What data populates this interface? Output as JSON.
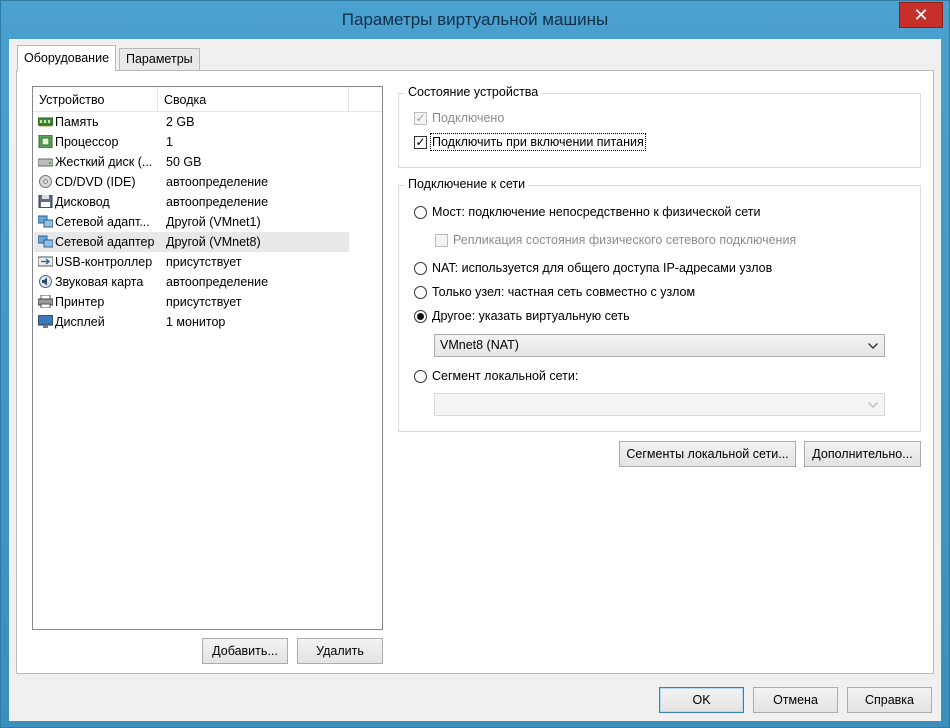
{
  "window": {
    "title": "Параметры виртуальной машины",
    "close_glyph": "✕"
  },
  "tabs": [
    {
      "label": "Оборудование",
      "active": true
    },
    {
      "label": "Параметры",
      "active": false
    }
  ],
  "device_list": {
    "columns": [
      "Устройство",
      "Сводка"
    ],
    "rows": [
      {
        "device": "Память",
        "summary": "2 GB",
        "icon": "memory-icon"
      },
      {
        "device": "Процессор",
        "summary": "1",
        "icon": "cpu-icon"
      },
      {
        "device": "Жесткий диск (...",
        "summary": "50 GB",
        "icon": "hard-disk-icon"
      },
      {
        "device": "CD/DVD (IDE)",
        "summary": "автоопределение",
        "icon": "cd-dvd-icon"
      },
      {
        "device": "Дисковод",
        "summary": "автоопределение",
        "icon": "floppy-icon"
      },
      {
        "device": "Сетевой адапт...",
        "summary": "Другой (VMnet1)",
        "icon": "network-adapter-icon"
      },
      {
        "device": "Сетевой адаптер",
        "summary": "Другой (VMnet8)",
        "icon": "network-adapter-icon",
        "selected": true
      },
      {
        "device": "USB-контроллер",
        "summary": "присутствует",
        "icon": "usb-icon"
      },
      {
        "device": "Звуковая карта",
        "summary": "автоопределение",
        "icon": "sound-card-icon"
      },
      {
        "device": "Принтер",
        "summary": "присутствует",
        "icon": "printer-icon"
      },
      {
        "device": "Дисплей",
        "summary": "1 монитор",
        "icon": "display-icon"
      }
    ]
  },
  "list_buttons": {
    "add": "Добавить...",
    "remove": "Удалить"
  },
  "device_status": {
    "title": "Состояние устройства",
    "connected": {
      "label": "Подключено",
      "checked": true,
      "enabled": false
    },
    "connect_at_power_on": {
      "label": "Подключить при включении питания",
      "checked": true,
      "enabled": true
    }
  },
  "network_connection": {
    "title": "Подключение к сети",
    "bridged": {
      "label": "Мост: подключение непосредственно к физической сети",
      "selected": false
    },
    "replicate": {
      "label": "Репликация состояния физического сетевого подключения",
      "checked": false,
      "enabled": false
    },
    "nat": {
      "label": "NAT: используется для общего доступа IP-адресами узлов",
      "selected": false
    },
    "host_only": {
      "label": "Только узел: частная сеть совместно с узлом",
      "selected": false
    },
    "custom": {
      "label": "Другое: указать виртуальную сеть",
      "selected": true
    },
    "custom_network_value": "VMnet8 (NAT)",
    "lan_segment": {
      "label": "Сегмент локальной сети:",
      "selected": false
    },
    "lan_segment_value": ""
  },
  "action_buttons": {
    "lan_segments": "Сегменты локальной сети...",
    "advanced": "Дополнительно..."
  },
  "dialog_buttons": {
    "ok": "OK",
    "cancel": "Отмена",
    "help": "Справка"
  },
  "colors": {
    "window_accent": "#3b8fbd",
    "close_button": "#c7302a",
    "selected_row": "#e8e8e8"
  }
}
